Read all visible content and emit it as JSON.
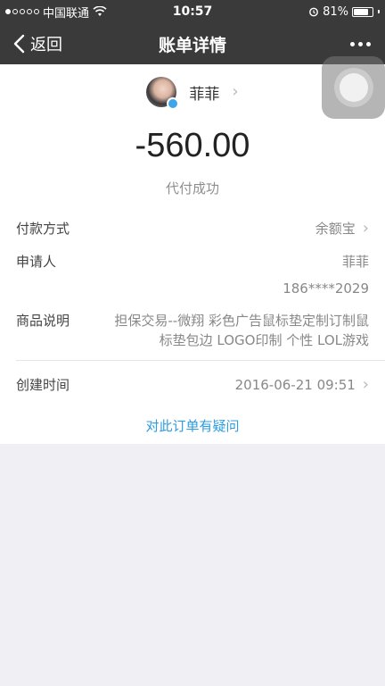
{
  "status_bar": {
    "carrier": "中国联通",
    "time": "10:57",
    "battery_percent": "81%",
    "battery_level": 0.81
  },
  "nav": {
    "back_label": "返回",
    "title": "账单详情"
  },
  "user": {
    "name": "菲菲"
  },
  "transaction": {
    "amount": "-560.00",
    "status": "代付成功"
  },
  "details": {
    "payment_method": {
      "label": "付款方式",
      "value": "余额宝"
    },
    "applicant": {
      "label": "申请人",
      "name": "菲菲",
      "phone": "186****2029"
    },
    "product": {
      "label": "商品说明",
      "value": "担保交易--微翔 彩色广告鼠标垫定制订制鼠标垫包边 LOGO印制 个性 LOL游戏"
    },
    "created": {
      "label": "创建时间",
      "value": "2016-06-21 09:51"
    }
  },
  "question_link": "对此订单有疑问",
  "icons": {
    "back": "chevron-left-icon",
    "more": "more-dots-icon",
    "chevron": "chevron-right-icon",
    "wifi": "wifi-icon",
    "alarm": "alarm-icon",
    "battery": "battery-icon"
  },
  "colors": {
    "nav_background": "#3a3a3a",
    "link": "#2b9de0",
    "page_background": "#efeff4"
  }
}
